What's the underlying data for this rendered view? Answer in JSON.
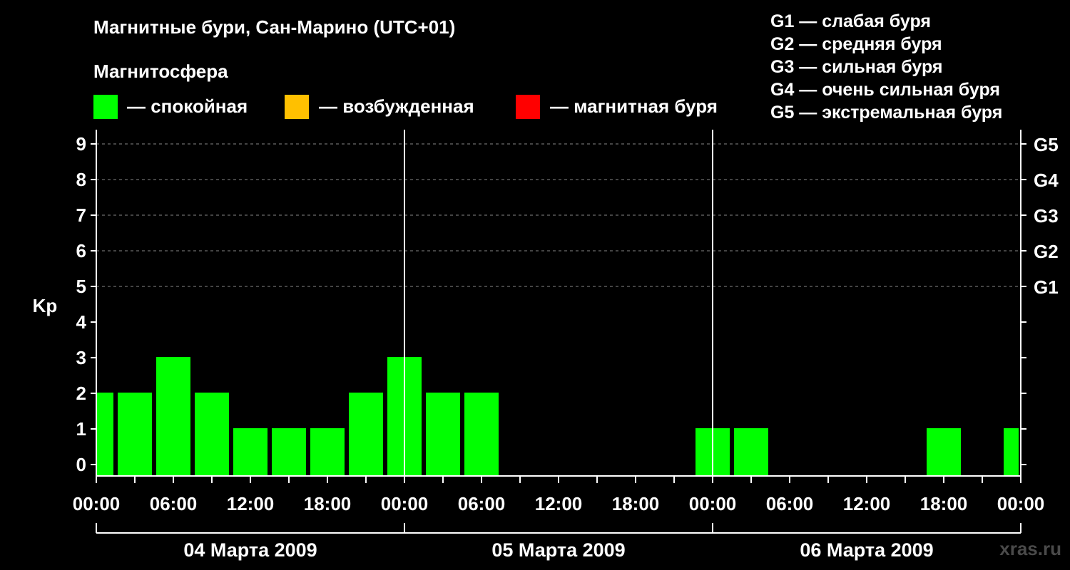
{
  "title": "Магнитные бури, Сан-Марино (UTC+01)",
  "magnetosphere": {
    "title": "Магнитосфера",
    "items": [
      {
        "label": "— спокойная",
        "color": "#00ff00"
      },
      {
        "label": "— возбужденная",
        "color": "#ffc000"
      },
      {
        "label": "— магнитная буря",
        "color": "#ff0000"
      }
    ]
  },
  "storm_scale": [
    "G1 — слабая буря",
    "G2 — средняя буря",
    "G3 — сильная буря",
    "G4 — очень сильная буря",
    "G5 — экстремальная буря"
  ],
  "watermark": "xras.ru",
  "chart_data": {
    "type": "bar",
    "ylabel": "Kp",
    "ylim": [
      0,
      9
    ],
    "yticks": [
      "0",
      "1",
      "2",
      "3",
      "4",
      "5",
      "6",
      "7",
      "8",
      "9"
    ],
    "right_axis_labels": [
      {
        "kp": 5,
        "label": "G1"
      },
      {
        "kp": 6,
        "label": "G2"
      },
      {
        "kp": 7,
        "label": "G3"
      },
      {
        "kp": 8,
        "label": "G4"
      },
      {
        "kp": 9,
        "label": "G5"
      }
    ],
    "x_tick_labels": [
      "00:00",
      "06:00",
      "12:00",
      "18:00",
      "00:00",
      "06:00",
      "12:00",
      "18:00",
      "00:00",
      "06:00",
      "12:00",
      "18:00",
      "00:00"
    ],
    "days": [
      "04 Марта 2009",
      "05 Марта 2009",
      "06 Марта 2009"
    ],
    "interval_hours": 3,
    "grid": "dashed horizontal at Kp 5–9",
    "bar_color": "#00ff00",
    "series": [
      {
        "values": [
          2,
          2,
          3,
          2,
          1,
          1,
          1,
          2,
          3,
          2,
          2,
          0,
          0,
          0,
          0,
          0,
          1,
          1,
          0,
          0,
          0,
          0,
          1,
          0,
          1
        ]
      }
    ],
    "first_bar_partial": true,
    "last_bar_partial": true
  }
}
